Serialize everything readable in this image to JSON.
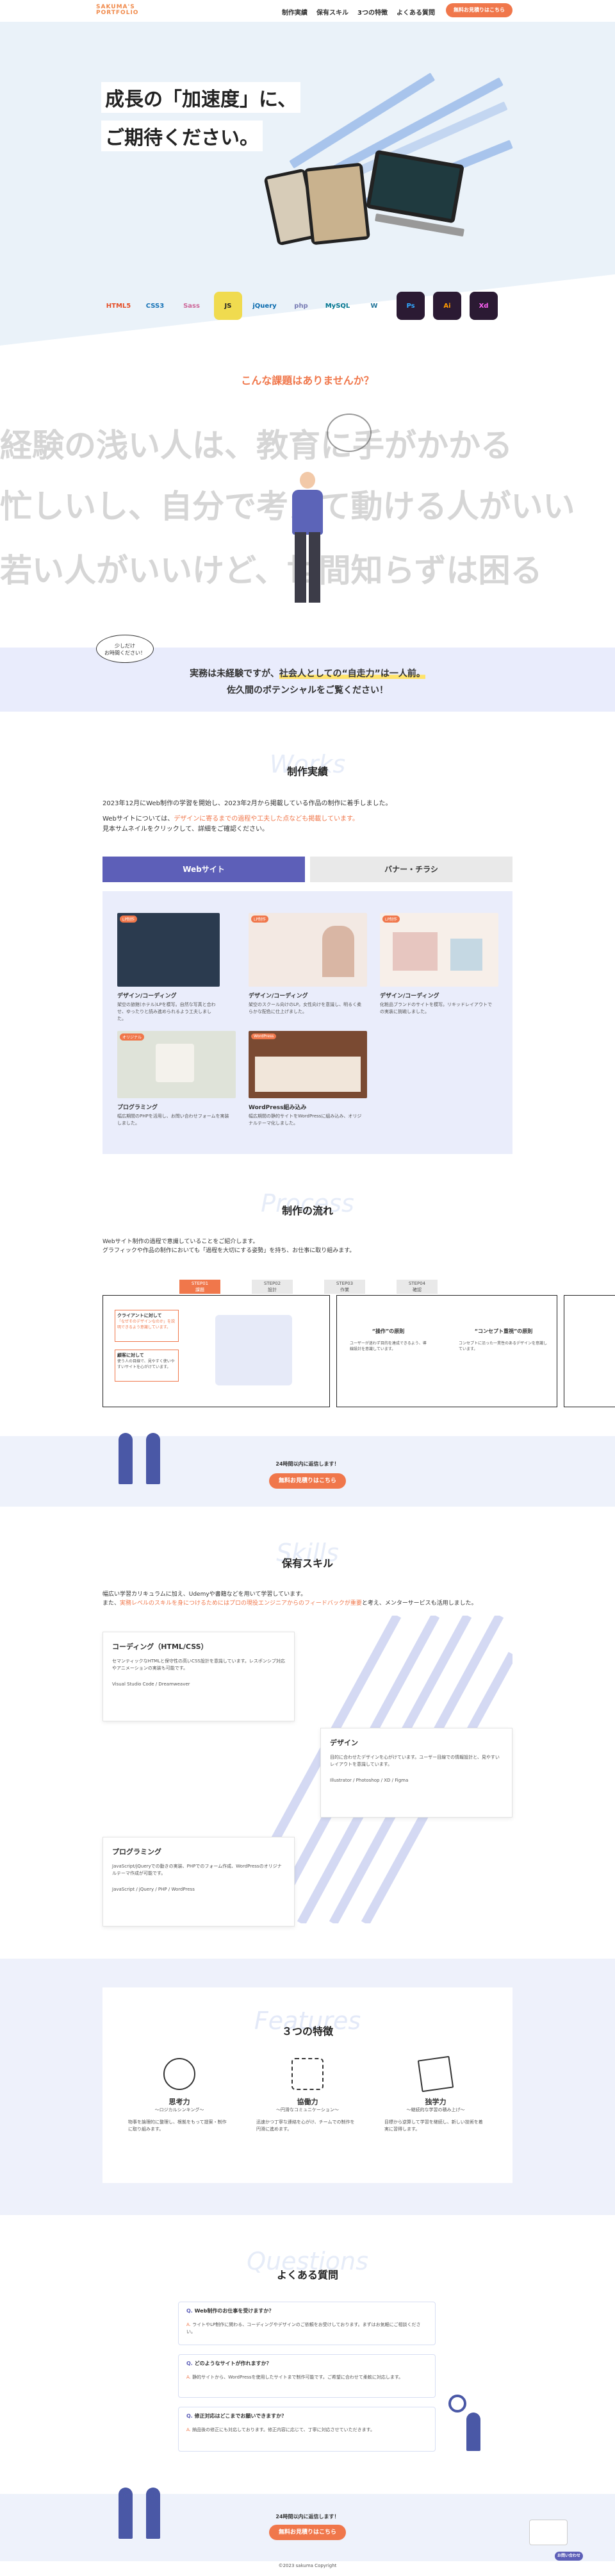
{
  "header": {
    "logo_line1": "SAKUMA'S",
    "logo_line2": "PORTFOLIO",
    "nav": [
      "制作実績",
      "保有スキル",
      "3つの特徴",
      "よくある質問"
    ],
    "cta": "無料お見積りはこちら"
  },
  "hero": {
    "line1": "成長の「加速度」に、",
    "line2": "ご期待ください。"
  },
  "tech_icons": [
    {
      "name": "html5-icon",
      "label": "HTML5",
      "color": "#e44d26"
    },
    {
      "name": "css3-icon",
      "label": "CSS3",
      "color": "#1572b6"
    },
    {
      "name": "sass-icon",
      "label": "Sass",
      "color": "#cd6799"
    },
    {
      "name": "js-icon",
      "label": "JS",
      "color": "#f0db4f"
    },
    {
      "name": "jquery-icon",
      "label": "jQuery",
      "color": "#0769ad"
    },
    {
      "name": "php-icon",
      "label": "php",
      "color": "#777bb3"
    },
    {
      "name": "mysql-icon",
      "label": "MySQL",
      "color": "#00758f"
    },
    {
      "name": "wordpress-icon",
      "label": "W",
      "color": "#21759b"
    },
    {
      "name": "photoshop-icon",
      "label": "Ps",
      "color": "#31a8ff"
    },
    {
      "name": "illustrator-icon",
      "label": "Ai",
      "color": "#ff9a00"
    },
    {
      "name": "xd-icon",
      "label": "Xd",
      "color": "#ff61f6"
    }
  ],
  "problems": {
    "title": "こんな課題はありませんか？",
    "lines": [
      "経験の浅い人は、教育に手がかかる",
      "忙しいし、自分で考えて動ける人がいい",
      "若い人がいいけど、世間知らずは困る"
    ]
  },
  "appeal": {
    "bubble": "少しだけ\nお時間ください！",
    "line1_a": "実務は未経験ですが、",
    "line1_b": "社会人としての“自走力”は一人前。",
    "line2": "佐久間のポテンシャルをご覧ください！"
  },
  "works": {
    "ghost": "Works",
    "title": "制作実績",
    "intro1": "2023年12月にWeb制作の学習を開始し、2023年2月から掲載している作品の制作に着手しました。",
    "intro2a": "Webサイトについては、",
    "intro2b": "デザインに寄るまでの過程や工夫した点なども掲載しています。",
    "intro3": "見本サムネイルをクリックして、詳細をご確認ください。",
    "tab_web": "Webサイト",
    "tab_banner": "バナー・チラシ",
    "items": [
      {
        "tag": "LP制作",
        "title": "デザイン/コーディング",
        "desc": "架空の旅館(ホテル)LPを模写。自然な写真と合わせ、ゆったりと読み進められるよう工夫しました。"
      },
      {
        "tag": "LP制作",
        "title": "デザイン/コーディング",
        "desc": "架空のスクール向けのLP。女性向けを意識し、明るく柔らかな配色に仕上げました。"
      },
      {
        "tag": "LP制作",
        "title": "デザイン/コーディング",
        "desc": "化粧品ブランドのサイトを模写。リキッドレイアウトでの実装に挑戦しました。"
      },
      {
        "tag": "オリジナル",
        "title": "プログラミング",
        "desc": "幅広期間のPHPを活用し、お問い合わせフォームを実装しました。"
      },
      {
        "tag": "WordPress",
        "title": "WordPress組み込み",
        "desc": "幅広期間の静的サイトをWordPressに組み込み、オリジナルテーマ化しました。"
      }
    ]
  },
  "process": {
    "ghost": "Process",
    "title": "制作の流れ",
    "intro1": "Webサイト制作の過程で意識していることをご紹介します。",
    "intro2": "グラフィックや作品の制作においても「過程を大切にする姿勢」を持ち、お仕事に取り組みます。",
    "steps": [
      {
        "num": "STEP01",
        "label": "課題"
      },
      {
        "num": "STEP02",
        "label": "設計"
      },
      {
        "num": "STEP03",
        "label": "作業"
      },
      {
        "num": "STEP04",
        "label": "確認"
      }
    ],
    "card1_h1": "クライアントに対して",
    "card1_p1": "「なぜそのデザインなのか」を説明できるよう意識しています。",
    "card1_h2": "顧客に対して",
    "card1_p2": "使う人の目線で、見やすく使いやすいサイトを心がけています。",
    "card2_h": "“操作”の原則",
    "card2_p": "ユーザーが迷わず目的を達成できるよう、導線設計を意識しています。",
    "card3_h": "“コンセプト重視”の原則",
    "card3_p": "コンセプトに沿った一貫性のあるデザインを意識しています。",
    "cta_note": "24時間以内に返信します！",
    "cta": "無料お見積りはこちら"
  },
  "skills": {
    "ghost": "Skills",
    "title": "保有スキル",
    "intro1": "幅広い学習カリキュラムに加え、Udemyや書籍などを用いて学習しています。",
    "intro2a": "また、",
    "intro2b": "実務レベルのスキルを身につけるためにはプロの現役エンジニアからのフィードバックが重要",
    "intro2c": "と考え、メンターサービスも活用しました。",
    "cards": [
      {
        "title": "コーディング（HTML/CSS）",
        "desc": "セマンティックなHTMLと保守性の高いCSS設計を意識しています。レスポンシブ対応やアニメーションの実装も可能です。",
        "tools": "Visual Studio Code / Dreamweaver"
      },
      {
        "title": "デザイン",
        "desc": "目的に合わせたデザインを心がけています。ユーザー目線での情報設計と、見やすいレイアウトを意識しています。",
        "tools": "Illustrator / Photoshop / XD / Figma"
      },
      {
        "title": "プログラミング",
        "desc": "JavaScript/jQueryでの動きの実装、PHPでのフォーム作成、WordPressのオリジナルテーマ作成が可能です。",
        "tools": "JavaScript / jQuery / PHP / WordPress"
      }
    ]
  },
  "features": {
    "ghost": "Features",
    "title": "３つの特徴",
    "items": [
      {
        "title": "思考力",
        "sub": "～ロジカルシンキング～",
        "desc": "物事を論理的に整理し、根拠をもって提案・制作に取り組みます。"
      },
      {
        "title": "協働力",
        "sub": "～円滑なコミュニケーション～",
        "desc": "迅速かつ丁寧な連絡を心がけ、チームでの制作を円滑に進めます。"
      },
      {
        "title": "独学力",
        "sub": "～継続的な学習の積み上げ～",
        "desc": "目標から逆算して学習を継続し、新しい技術を着実に習得します。"
      }
    ]
  },
  "faq": {
    "ghost": "Questions",
    "title": "よくある質問",
    "items": [
      {
        "q": "Web制作のお仕事を受けますか？",
        "a": "ライトやLP制作に関わる、コーディングやデザインのご依頼をお受けしております。まずはお気軽にご相談ください。"
      },
      {
        "q": "どのようなサイトが作れますか？",
        "a": "静的サイトから、WordPressを使用したサイトまで制作可能です。ご希望に合わせて柔軟に対応します。"
      },
      {
        "q": "修正対応はどこまでお願いできますか？",
        "a": "納品後の修正にも対応しております。修正内容に応じて、丁寧に対応させていただきます。"
      }
    ]
  },
  "footer_cta": {
    "note": "24時間以内に返信します！",
    "cta": "無料お見積りはこちら",
    "copyright": "©2023 sakuma Copyright",
    "float_btn": "お問い合わせ"
  }
}
